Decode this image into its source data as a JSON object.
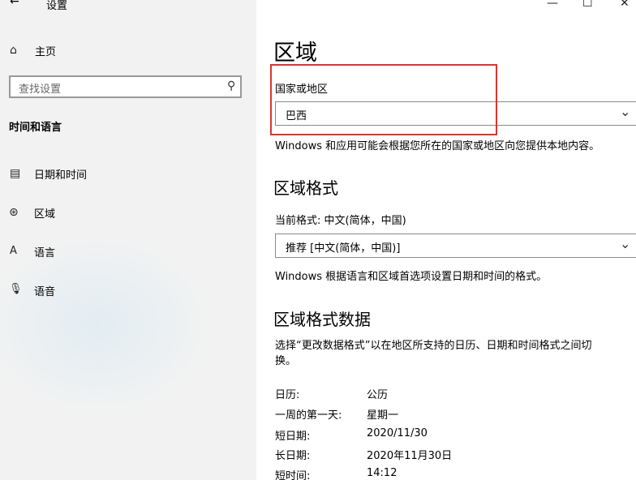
{
  "window": {
    "title": "设置",
    "back_icon": "←",
    "minimize_icon": "—",
    "maximize_icon": "☐",
    "close_icon": "✕"
  },
  "sidebar": {
    "home_icon": "⌂",
    "home_label": "主页",
    "search_placeholder": "查找设置",
    "search_icon": "⚲",
    "section_title": "时间和语言",
    "items": [
      {
        "icon": "▤",
        "label": "日期和时间"
      },
      {
        "icon": "⊛",
        "label": "区域"
      },
      {
        "icon": "A",
        "label": "语言"
      },
      {
        "icon": "🎙",
        "label": "语音"
      }
    ]
  },
  "main": {
    "page_title": "区域",
    "country": {
      "label": "国家或地区",
      "value": "巴西",
      "description": "Windows 和应用可能会根据您所在的国家或地区向您提供本地内容。"
    },
    "format": {
      "heading": "区域格式",
      "current_label": "当前格式: 中文(简体，中国)",
      "value": "推荐 [中文(简体，中国)]",
      "description": "Windows 根据语言和区域首选项设置日期和时间的格式。"
    },
    "format_data": {
      "heading": "区域格式数据",
      "description_line1": "选择“更改数据格式”以在地区所支持的日历、日期和时间格式之间切",
      "description_line2": "换。",
      "rows": [
        {
          "key": "日历:",
          "value": "公历"
        },
        {
          "key": "一周的第一天:",
          "value": "星期一"
        },
        {
          "key": "短日期:",
          "value": "2020/11/30"
        },
        {
          "key": "长日期:",
          "value": "2020年11月30日"
        },
        {
          "key": "短时间:",
          "value": "14:12"
        }
      ]
    },
    "chevron": "⌄"
  },
  "colors": {
    "highlight_border": "#d9362f",
    "sidebar_bg": "#f2f2f2"
  }
}
